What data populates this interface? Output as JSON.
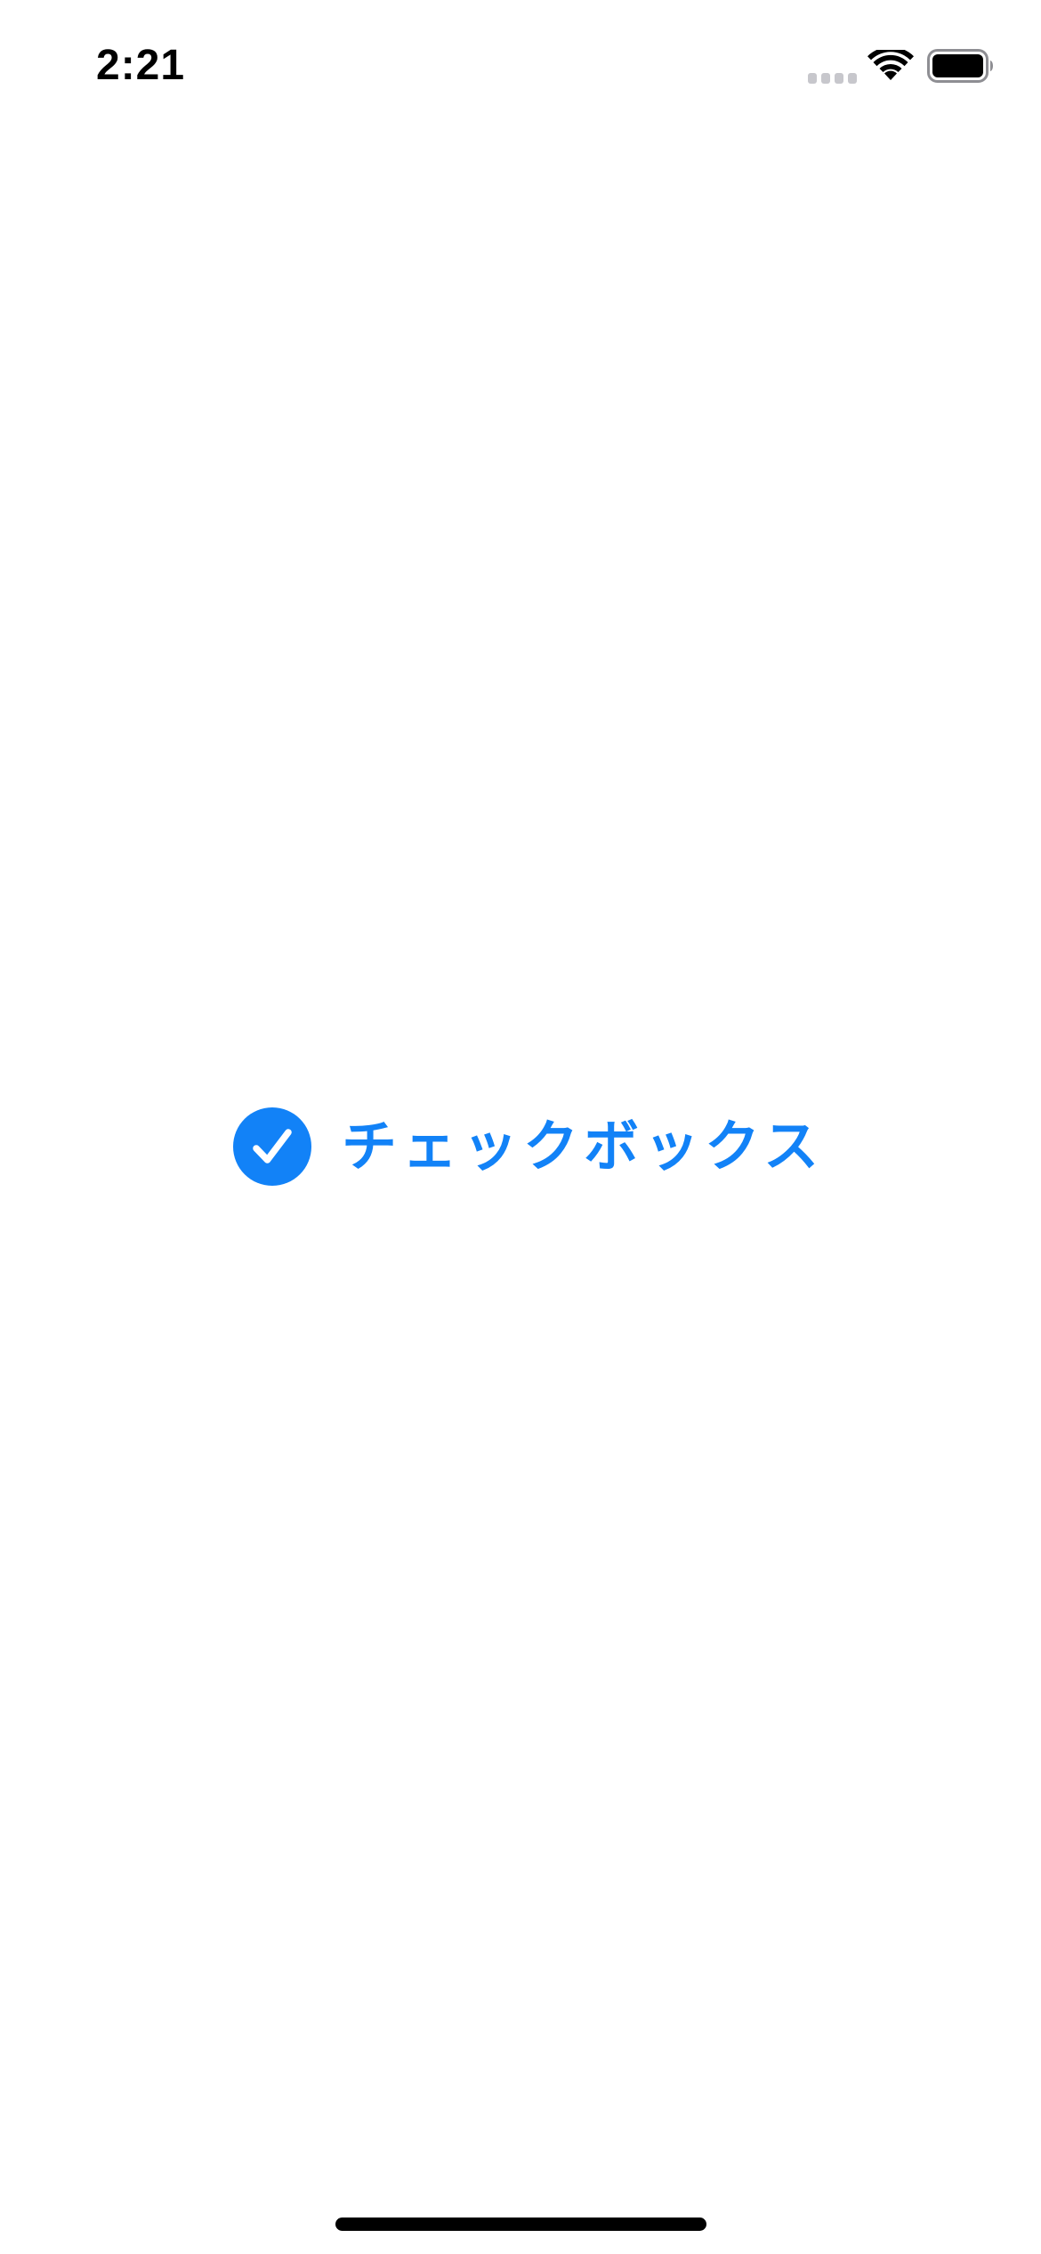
{
  "status_bar": {
    "time": "2:21",
    "cell_signal_icon": "cell-signal-icon",
    "wifi_icon": "wifi-icon",
    "battery_icon": "battery-icon"
  },
  "checkbox": {
    "label": "チェックボックス",
    "checked": true,
    "icon": "checkmark-circle-icon",
    "accent_color": "#1282f7"
  },
  "home_indicator": {
    "color": "#000000"
  }
}
